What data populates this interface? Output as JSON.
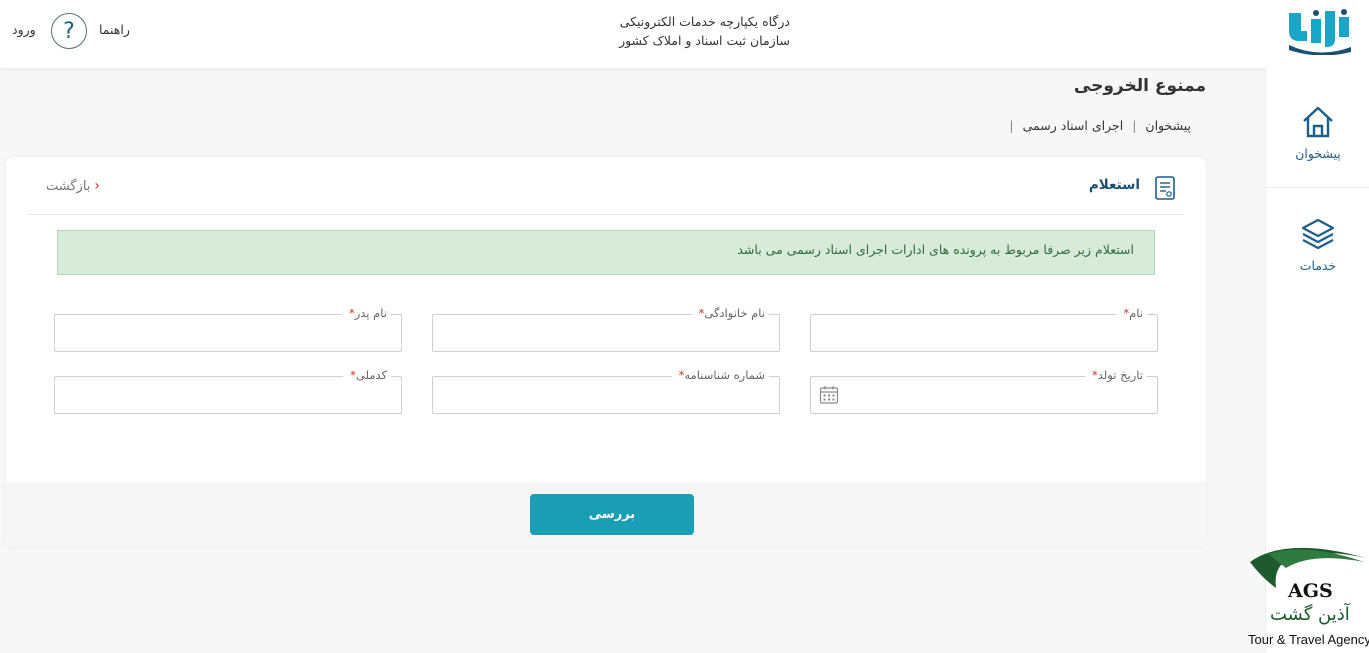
{
  "header": {
    "portal_line1": "درگاه یکپارچه خدمات الکترونیکی",
    "portal_line2": "سازمان ثبت اسناد و املاک کشور",
    "help_label": "راهنما",
    "help_glyph": "?",
    "login_label": "ورود",
    "brand_color": "#1d5f8a"
  },
  "sidebar": {
    "items": [
      {
        "label": "پیشخوان",
        "icon": "home-icon"
      },
      {
        "label": "خدمات",
        "icon": "layers-icon"
      }
    ]
  },
  "page": {
    "title": "ممنوع الخروجی",
    "breadcrumb": [
      "پیشخوان",
      "اجرای اسناد رسمی"
    ],
    "breadcrumb_sep": "|"
  },
  "card": {
    "title": "استعلام",
    "back_label": "بازگشت",
    "back_chevron": "‹",
    "notice": "استعلام زیر صرفا مربوط به پرونده های ادارات اجرای اسناد رسمی می باشد",
    "required_mark": "*",
    "fields": [
      {
        "label": "نام",
        "value": ""
      },
      {
        "label": "نام خانوادگی",
        "value": ""
      },
      {
        "label": "نام پدر",
        "value": ""
      },
      {
        "label": "تاریخ تولد",
        "value": ""
      },
      {
        "label": "شماره شناسنامه",
        "value": ""
      },
      {
        "label": "کدملی",
        "value": ""
      }
    ],
    "submit_label": "بررسی",
    "submit_color": "#1a9eb3"
  },
  "watermark": {
    "brand": "AGS",
    "name_fa": "آذین گشت",
    "tagline": "Tour & Travel Agency"
  }
}
